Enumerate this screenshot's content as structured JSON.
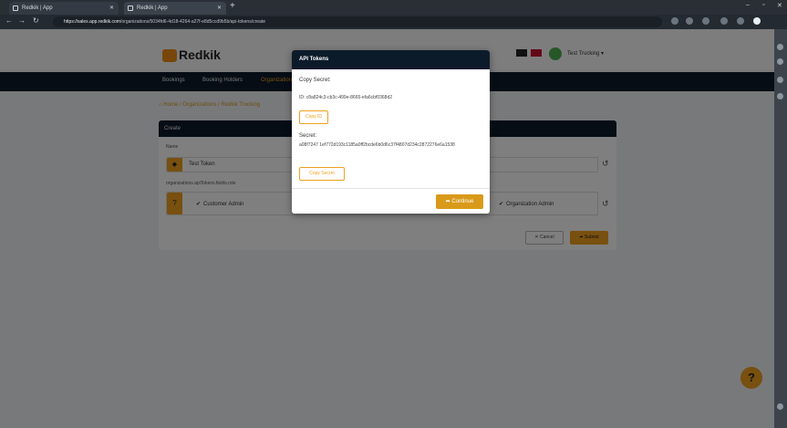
{
  "browser": {
    "tabs": [
      {
        "label": "Redkik | App"
      },
      {
        "label": "Redkik | App"
      }
    ],
    "url_host": "https://sales.app.redkik.com",
    "url_path": "/organizations/5034fd6-4d18-4264-a27f-e8d5ccd9b5b/api-tokens/create"
  },
  "app": {
    "logo_text": "Redkik",
    "user_name": "Test Trucking ▾",
    "nav": [
      "Bookings",
      "Booking Holders",
      "Organizations"
    ],
    "breadcrumb": "Home / Organizations / Redkik Trucking"
  },
  "form": {
    "card_title": "Create",
    "name_label": "Name",
    "name_value": "Test Token",
    "scopes_label": "organizations.apiTokens.fields.role",
    "scopes": [
      "Customer Admin",
      "Organization Admin"
    ],
    "cancel_label": "Cancel",
    "submit_label": "Submit"
  },
  "modal": {
    "title": "API Tokens",
    "copy_secret_heading": "Copy Secret:",
    "id_text": "ID: c8a824c3-cb3c-499e-8665-efa6cbf0368d2",
    "copy_id_label": "Copy ID",
    "secret_heading": "Secret:",
    "secret_value": "a08f7247 1ef772d193c1185a0ff2bcde6b0d6c37f4807d234c2872276e6a1538",
    "copy_secret_label": "Copy Secret",
    "continue_label": "Continue"
  },
  "help_label": "?",
  "colors": {
    "accent": "#f0a01f",
    "navy": "#0c1b2a"
  }
}
